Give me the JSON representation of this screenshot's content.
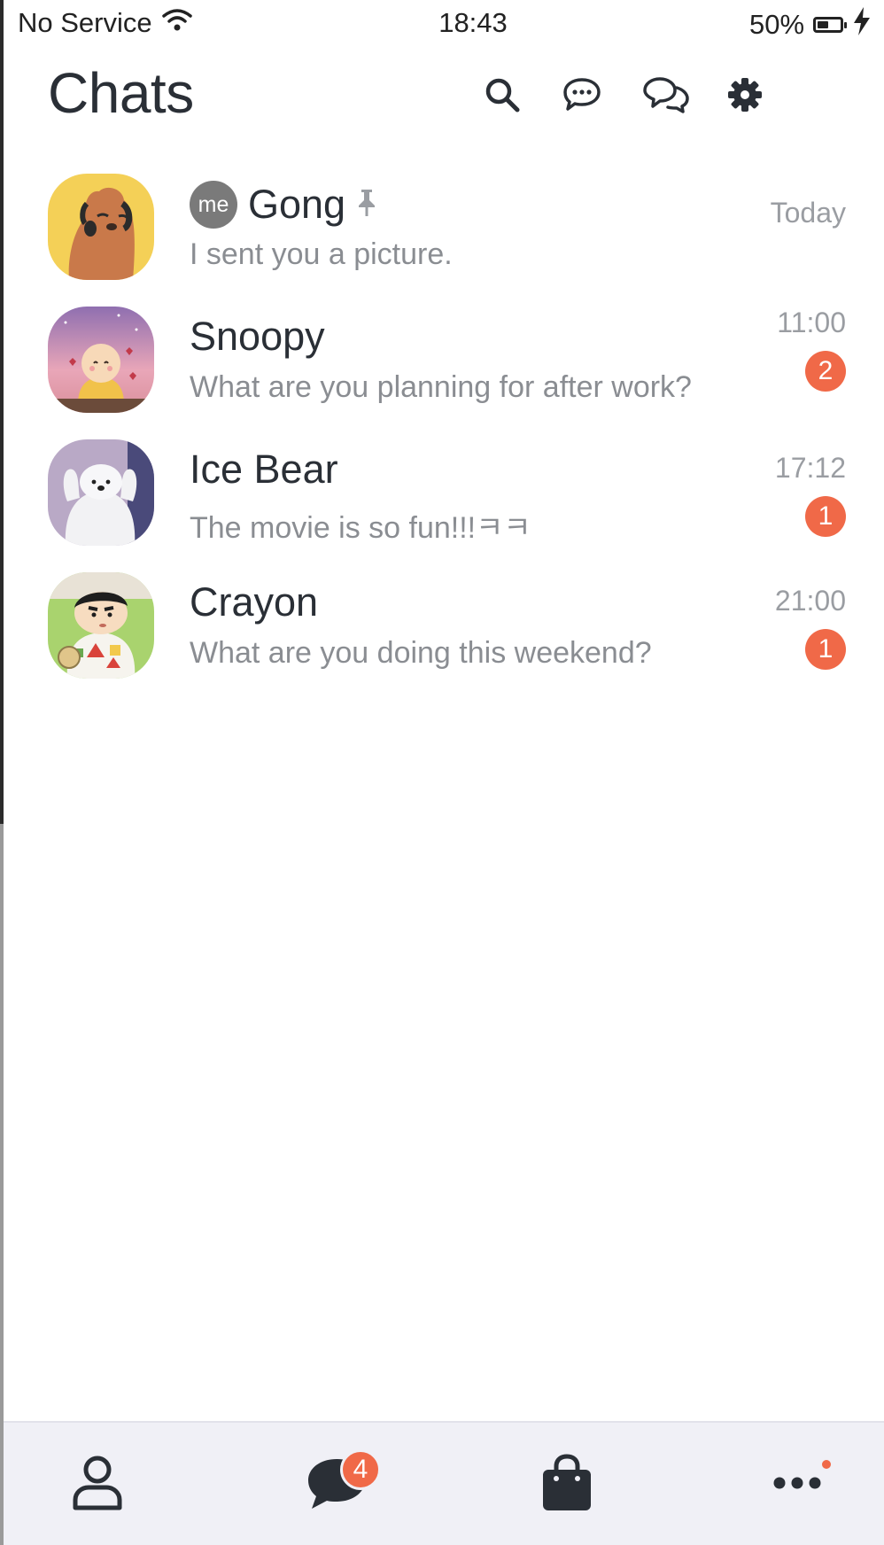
{
  "status_bar": {
    "carrier": "No Service",
    "time": "18:43",
    "battery_percent": "50%",
    "battery_level": 0.5,
    "icons": [
      "wifi-icon",
      "battery-icon",
      "charging-bolt-icon"
    ]
  },
  "header": {
    "title": "Chats",
    "actions": [
      "search-icon",
      "chat-bubble-icon",
      "open-chat-icon",
      "settings-gear-icon"
    ]
  },
  "chats": [
    {
      "name": "Gong",
      "me_badge": "me",
      "pinned": true,
      "message": "I sent you a picture.",
      "time": "Today",
      "unread": null
    },
    {
      "name": "Snoopy",
      "message": "What are you planning for after work?",
      "time": "11:00",
      "unread": "2"
    },
    {
      "name": "Ice Bear",
      "message": "The movie is so fun!!!ㅋㅋ",
      "time": "17:12",
      "unread": "1"
    },
    {
      "name": "Crayon",
      "message": "What are you doing this weekend?",
      "time": "21:00",
      "unread": "1"
    }
  ],
  "bottom_nav": {
    "items": [
      "friends-person-icon",
      "chats-bubble-icon",
      "shopping-bag-icon",
      "more-dots-icon"
    ],
    "chats_badge": "4"
  },
  "colors": {
    "accent_badge": "#f06948",
    "text_primary": "#2a2f36",
    "text_secondary": "#8a8d92",
    "nav_background": "#f0f0f6"
  }
}
